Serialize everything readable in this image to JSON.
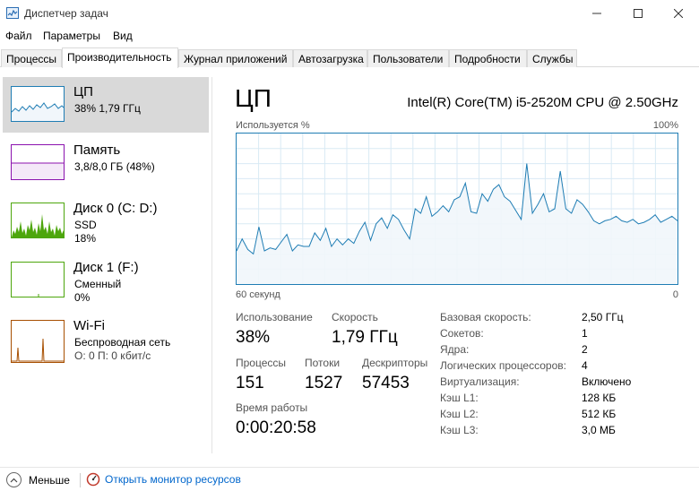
{
  "window": {
    "title": "Диспетчер задач",
    "icon": "task-manager-icon"
  },
  "menu": [
    "Файл",
    "Параметры",
    "Вид"
  ],
  "tabs": [
    {
      "label": "Процессы",
      "active": false
    },
    {
      "label": "Производительность",
      "active": true
    },
    {
      "label": "Журнал приложений",
      "active": false
    },
    {
      "label": "Автозагрузка",
      "active": false
    },
    {
      "label": "Пользователи",
      "active": false
    },
    {
      "label": "Подробности",
      "active": false
    },
    {
      "label": "Службы",
      "active": false
    }
  ],
  "sidebar": {
    "items": [
      {
        "name": "ЦП",
        "line1": "38% 1,79 ГГц",
        "line2": "",
        "color": "#1f7db4",
        "selected": true
      },
      {
        "name": "Память",
        "line1": "3,8/8,0 ГБ (48%)",
        "line2": "",
        "color": "#8b12ae",
        "selected": false
      },
      {
        "name": "Диск 0 (C: D:)",
        "line1": "SSD",
        "line2": "18%",
        "color": "#4da60c",
        "selected": false
      },
      {
        "name": "Диск 1 (F:)",
        "line1": "Сменный",
        "line2": "0%",
        "color": "#4da60c",
        "selected": false
      },
      {
        "name": "Wi-Fi",
        "line1": "Беспроводная сеть",
        "line2": "О: 0 П: 0 кбит/с",
        "color": "#a74f01",
        "selected": false
      }
    ]
  },
  "main": {
    "title": "ЦП",
    "cpu_model": "Intel(R) Core(TM) i5-2520M CPU @ 2.50GHz",
    "graph": {
      "label_top_left": "Используется %",
      "label_top_right": "100%",
      "label_bottom_left": "60 секунд",
      "label_bottom_right": "0",
      "color": "#1f7db4",
      "fill": "#f1f6fb",
      "grid_color": "#d9eaf4"
    },
    "stats": {
      "usage_label": "Использование",
      "usage_value": "38%",
      "speed_label": "Скорость",
      "speed_value": "1,79 ГГц",
      "processes_label": "Процессы",
      "processes_value": "151",
      "threads_label": "Потоки",
      "threads_value": "1527",
      "handles_label": "Дескрипторы",
      "handles_value": "57453",
      "uptime_label": "Время работы",
      "uptime_value": "0:00:20:58"
    },
    "info": [
      {
        "label": "Базовая скорость:",
        "value": "2,50 ГГц"
      },
      {
        "label": "Сокетов:",
        "value": "1"
      },
      {
        "label": "Ядра:",
        "value": "2"
      },
      {
        "label": "Логических процессоров:",
        "value": "4"
      },
      {
        "label": "Виртуализация:",
        "value": "Включено"
      },
      {
        "label": "Кэш L1:",
        "value": "128 КБ"
      },
      {
        "label": "Кэш L2:",
        "value": "512 КБ"
      },
      {
        "label": "Кэш L3:",
        "value": "3,0 МБ"
      }
    ]
  },
  "footer": {
    "fewer_label": "Меньше",
    "monitor_label": "Открыть монитор ресурсов"
  },
  "chart_data": {
    "type": "area",
    "title": "",
    "xlabel": "60 секунд",
    "ylabel": "Используется %",
    "xlim": [
      60,
      0
    ],
    "ylim": [
      0,
      100
    ],
    "grid": true,
    "series": [
      {
        "values": [
          22,
          30,
          23,
          20,
          38,
          22,
          24,
          23,
          28,
          33,
          22,
          26,
          25,
          25,
          34,
          29,
          37,
          25,
          30,
          26,
          30,
          27,
          35,
          41,
          29,
          40,
          44,
          37,
          46,
          43,
          36,
          30,
          50,
          47,
          58,
          45,
          48,
          52,
          48,
          56,
          58,
          67,
          48,
          47,
          60,
          55,
          63,
          66,
          58,
          55,
          49,
          43,
          80,
          47,
          53,
          60,
          48,
          50,
          75,
          50,
          47,
          56,
          53,
          48,
          42,
          40,
          42,
          43,
          45,
          42,
          41,
          43,
          40,
          41,
          43,
          46,
          41,
          43,
          45,
          42
        ]
      }
    ]
  }
}
